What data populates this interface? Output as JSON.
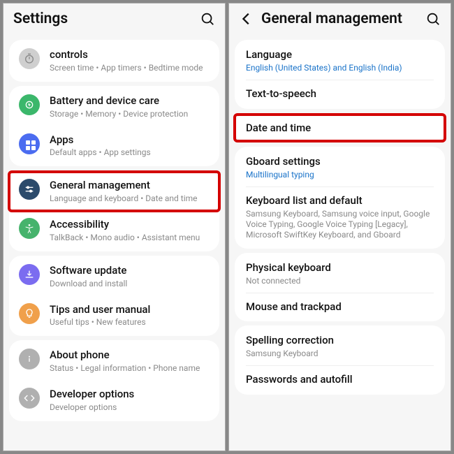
{
  "left": {
    "title": "Settings",
    "items": [
      {
        "icon": "timer-icon",
        "color": "c-grey",
        "title": "controls",
        "sub": "Screen time  •  App timers  •  Bedtime mode"
      },
      {
        "icon": "battery-icon",
        "color": "c-green",
        "title": "Battery and device care",
        "sub": "Storage  •  Memory  •  Device protection"
      },
      {
        "icon": "apps-icon",
        "color": "c-blue",
        "title": "Apps",
        "sub": "Default apps  •  App settings"
      },
      {
        "icon": "sliders-icon",
        "color": "c-navy",
        "title": "General management",
        "sub": "Language and keyboard  •  Date and time",
        "hl": true
      },
      {
        "icon": "accessibility-icon",
        "color": "c-green2",
        "title": "Accessibility",
        "sub": "TalkBack  •  Mono audio  •  Assistant menu"
      },
      {
        "icon": "update-icon",
        "color": "c-lilac",
        "title": "Software update",
        "sub": "Download and install"
      },
      {
        "icon": "tips-icon",
        "color": "c-orange",
        "title": "Tips and user manual",
        "sub": "Useful tips  •  New features"
      },
      {
        "icon": "info-icon",
        "color": "c-grey2",
        "title": "About phone",
        "sub": "Status  •  Legal information  •  Phone name"
      },
      {
        "icon": "dev-icon",
        "color": "c-grey2",
        "title": "Developer options",
        "sub": "Developer options"
      }
    ]
  },
  "right": {
    "title": "General management",
    "items": [
      {
        "title": "Language",
        "sub": "English (United States) and English (India)",
        "link": true,
        "group": 0
      },
      {
        "title": "Text-to-speech",
        "group": 0
      },
      {
        "title": "Date and time",
        "hl": true,
        "group": 1
      },
      {
        "title": "Gboard settings",
        "sub": "Multilingual typing",
        "link": true,
        "group": 2
      },
      {
        "title": "Keyboard list and default",
        "sub": "Samsung Keyboard, Samsung voice input, Google Voice Typing, Google Voice Typing [Legacy], Microsoft SwiftKey Keyboard, and Gboard",
        "group": 2
      },
      {
        "title": "Physical keyboard",
        "sub": "Not connected",
        "group": 3
      },
      {
        "title": "Mouse and trackpad",
        "group": 3
      },
      {
        "title": "Spelling correction",
        "sub": "Samsung Keyboard",
        "group": 4
      },
      {
        "title": "Passwords and autofill",
        "group": 4
      }
    ]
  }
}
